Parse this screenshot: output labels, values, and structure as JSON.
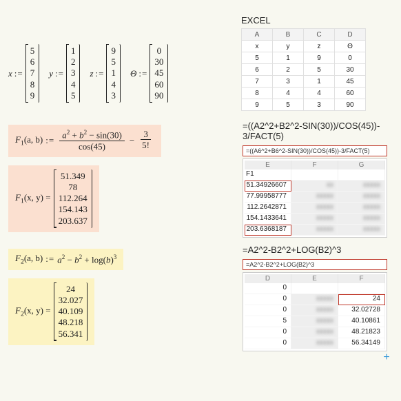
{
  "excel_label": "EXCEL",
  "vectors": {
    "x": {
      "name": "x",
      "values": [
        "5",
        "6",
        "7",
        "8",
        "9"
      ]
    },
    "y": {
      "name": "y",
      "values": [
        "1",
        "2",
        "3",
        "4",
        "5"
      ]
    },
    "z": {
      "name": "z",
      "values": [
        "9",
        "5",
        "1",
        "4",
        "3"
      ]
    },
    "theta": {
      "name": "Θ",
      "values": [
        "0",
        "30",
        "45",
        "60",
        "90"
      ]
    }
  },
  "coloneq": ":=",
  "excel_table": {
    "cols": [
      "A",
      "B",
      "C",
      "D"
    ],
    "rows": [
      [
        "x",
        "y",
        "z",
        "Θ"
      ],
      [
        "5",
        "1",
        "9",
        "0"
      ],
      [
        "6",
        "2",
        "5",
        "30"
      ],
      [
        "7",
        "3",
        "1",
        "45"
      ],
      [
        "8",
        "4",
        "4",
        "60"
      ],
      [
        "9",
        "5",
        "3",
        "90"
      ]
    ]
  },
  "f1": {
    "name": "F",
    "sub": "1",
    "args": "(a, b)",
    "num": "a² + b² − sin(30)",
    "den": "cos(45)",
    "minus_frac_num": "3",
    "minus_frac_den": "5!",
    "result_label": "F₁(x, y) =",
    "result_args": "(x, y)",
    "results": [
      "51.349",
      "78",
      "112.264",
      "154.143",
      "203.637"
    ],
    "excel_formula": "=((A2^2+B2^2-SIN(30))/COS(45))-3/FACT(5)",
    "formula_bar": "=((A6^2+B6^2-SIN(30))/COS(45))-3/FACT(5)",
    "mini_cols": [
      "E",
      "F",
      "G"
    ],
    "mini_f1_label": "F1",
    "mini_values": [
      "51.34926607",
      "77.99958777",
      "112.2642871",
      "154.1433641",
      "203.6368187"
    ]
  },
  "f2": {
    "name": "F",
    "sub": "2",
    "args": "(a, b)",
    "expr_pre": "a² − b² + log(b)",
    "expr_sup": "3",
    "result_args": "(x, y)",
    "results": [
      "24",
      "32.027",
      "40.109",
      "48.218",
      "56.341"
    ],
    "excel_formula": "=A2^2-B2^2+LOG(B2)^3",
    "formula_bar": "=A2^2-B2^2+LOG(B2)^3",
    "mini_cols": [
      "D",
      "E",
      "F"
    ],
    "mini_left": [
      "0",
      "0",
      "0",
      "5",
      "0",
      "0"
    ],
    "mini_values": [
      "24",
      "32.02728",
      "40.10861",
      "48.21823",
      "56.34149"
    ]
  },
  "plus": "+"
}
